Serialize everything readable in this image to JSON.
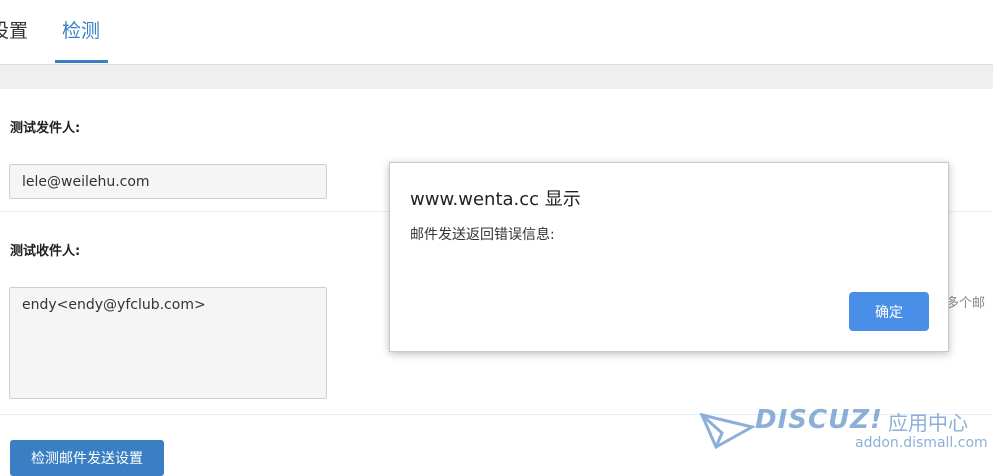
{
  "tabs": [
    {
      "label": "设置"
    },
    {
      "label": "检测"
    }
  ],
  "form": {
    "sender_label": "测试发件人:",
    "sender_value": "lele@weilehu.com",
    "recipient_label": "测试收件人:",
    "recipient_value": "endy<endy@yfclub.com>",
    "recipient_hint": "多个邮",
    "submit_label": "检测邮件发送设置"
  },
  "dialog": {
    "title": "www.wenta.cc 显示",
    "message": "邮件发送返回错误信息:",
    "ok_label": "确定"
  },
  "watermark": {
    "brand": "DISCUZ!",
    "brand_cn": "应用中心",
    "url": "addon.dismall.com"
  }
}
